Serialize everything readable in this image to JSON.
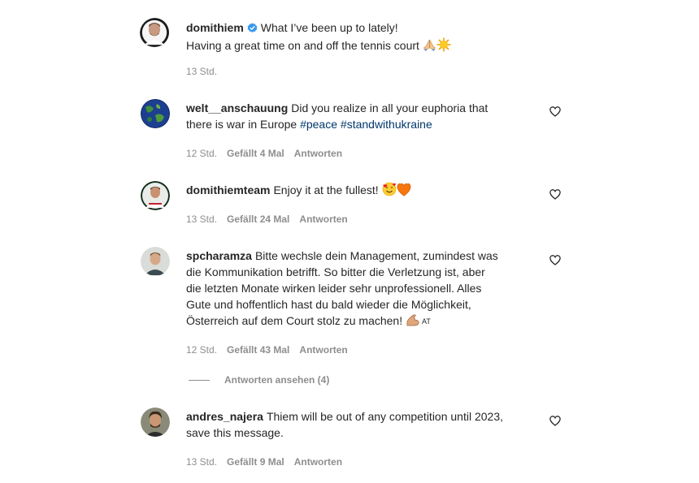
{
  "post": {
    "username": "domithiem",
    "verified": true,
    "caption_line1": "What I’ve been up to lately!",
    "caption_line2": "Having a great time on and off the tennis court",
    "emojis": [
      "folded-hands",
      "sun"
    ],
    "time": "13 Std."
  },
  "comments": [
    {
      "username": "welt__anschauung",
      "text_line1": "Did you realize in all your euphoria that",
      "text_line2": "there is war in Europe",
      "hashtags": [
        "#peace",
        "#standwithukraine"
      ],
      "time": "12 Std.",
      "likes": "Gefällt 4 Mal",
      "reply": "Antworten"
    },
    {
      "username": "domithiemteam",
      "text": "Enjoy it at the fullest!",
      "emojis": [
        "smiling-face-with-hearts",
        "orange-heart"
      ],
      "time": "13 Std.",
      "likes": "Gefällt 24 Mal",
      "reply": "Antworten"
    },
    {
      "username": "spcharamza",
      "text_line1": "Bitte wechsle dein Management, zumindest was",
      "text_line2": "die Kommunikation betrifft. So bitter die Verletzung ist, aber",
      "text_line3": "die letzten Monate wirken leider sehr unprofessionell. Alles",
      "text_line4": "Gute und hoffentlich hast du bald wieder die Möglichkeit,",
      "text_line5": "Österreich auf dem Court stolz zu machen!",
      "flag_tag": "AT",
      "emojis": [
        "flexed-biceps"
      ],
      "time": "12 Std.",
      "likes": "Gefällt 43 Mal",
      "reply": "Antworten",
      "view_replies": "Antworten ansehen (4)"
    },
    {
      "username": "andres_najera",
      "text_line1": "Thiem will be out of any competition until 2023,",
      "text_line2": "save this message.",
      "time": "13 Std.",
      "likes": "Gefällt 9 Mal",
      "reply": "Antworten"
    }
  ],
  "colors": {
    "text": "#262626",
    "meta": "#8e8e8e",
    "hashtag": "#00376b",
    "verified": "#3897f0"
  }
}
